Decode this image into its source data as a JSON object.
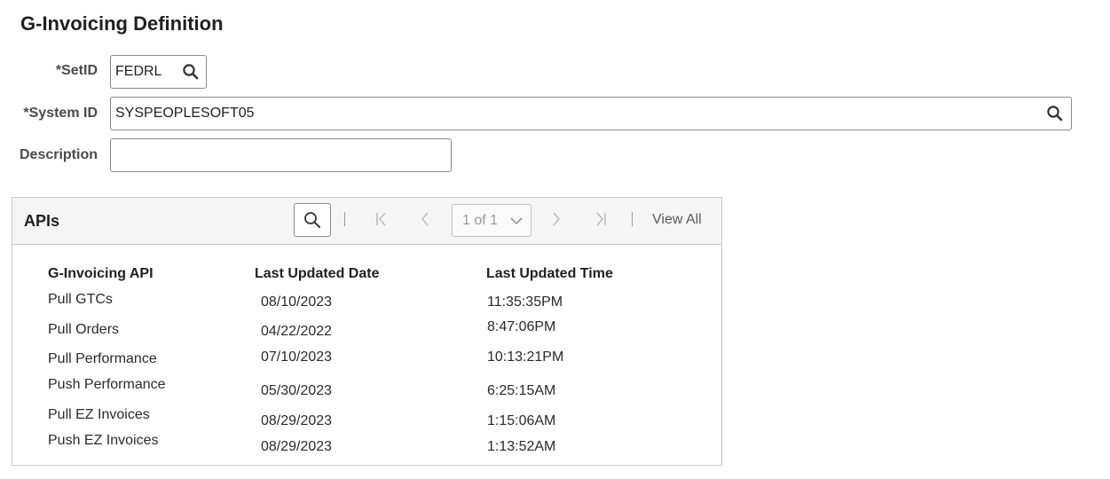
{
  "page": {
    "title": "G-Invoicing Definition"
  },
  "form": {
    "setid": {
      "label": "*SetID",
      "value": "FEDRL"
    },
    "system_id": {
      "label": "*System ID",
      "value": "SYSPEOPLESOFT05"
    },
    "description": {
      "label": "Description",
      "value": ""
    }
  },
  "apis_grid": {
    "title": "APIs",
    "pager": {
      "value": "1 of 1"
    },
    "view_all": "View All",
    "columns": [
      "G-Invoicing API",
      "Last Updated Date",
      "Last Updated Time"
    ],
    "rows": [
      {
        "api": "Pull GTCs",
        "date": "08/10/2023",
        "time": "11:35:35PM"
      },
      {
        "api": "Pull Orders",
        "date": "04/22/2022",
        "time": "8:47:06PM"
      },
      {
        "api": "Pull Performance",
        "date": "07/10/2023",
        "time": "10:13:21PM"
      },
      {
        "api": "Push Performance",
        "date": "05/30/2023",
        "time": "6:25:15AM"
      },
      {
        "api": "Pull EZ Invoices",
        "date": "08/29/2023",
        "time": "1:15:06AM"
      },
      {
        "api": "Push EZ Invoices",
        "date": "08/29/2023",
        "time": "1:13:52AM"
      }
    ]
  },
  "icons": {
    "lookup": "search-icon",
    "first": "first-page-icon",
    "prev": "chevron-left-icon",
    "next": "chevron-right-icon",
    "last": "last-page-icon",
    "dropdown": "chevron-down-icon"
  }
}
